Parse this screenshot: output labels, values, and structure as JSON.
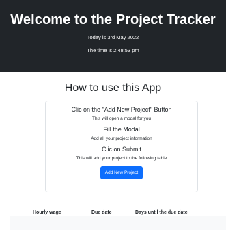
{
  "header": {
    "title": "Welcome to the Project Tracker",
    "date_text": "Today is 3rd May 2022",
    "time_text": "The time is 2:48:53 pm"
  },
  "instructions": {
    "title": "How to use this App",
    "steps": [
      {
        "title": "Clic on the \"Add New Project\" Button",
        "description": "This will open a modal for you"
      },
      {
        "title": "Fill the Modal",
        "description": "Add all your project information"
      },
      {
        "title": "Clic on Submit",
        "description": "This will add your project to the following table"
      }
    ],
    "button_label": "Add New Project"
  },
  "table": {
    "columns": [
      "Hourly wage",
      "Due date",
      "Days until the due date"
    ]
  }
}
